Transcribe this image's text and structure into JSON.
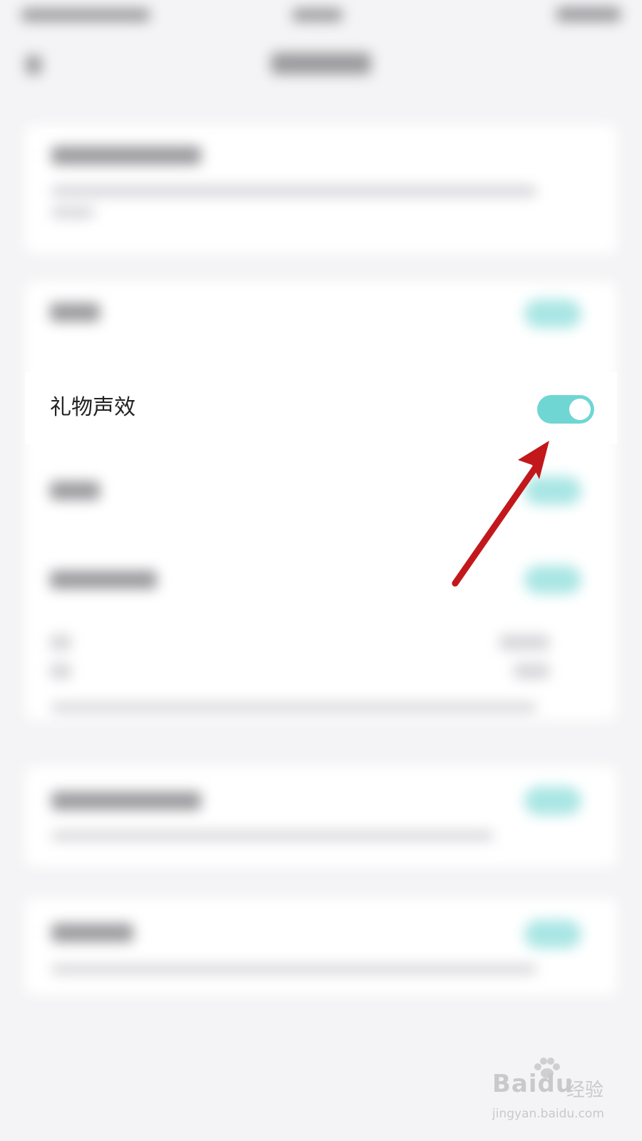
{
  "settings": {
    "gift_sound": {
      "label": "礼物声效",
      "enabled": true
    }
  },
  "colors": {
    "toggle_on": "#6fd6d3",
    "arrow": "#c3181b",
    "page_background": "#f4f4f6"
  },
  "watermark": {
    "logo": "Baidu",
    "suffix": "经验",
    "url": "jingyan.baidu.com"
  }
}
